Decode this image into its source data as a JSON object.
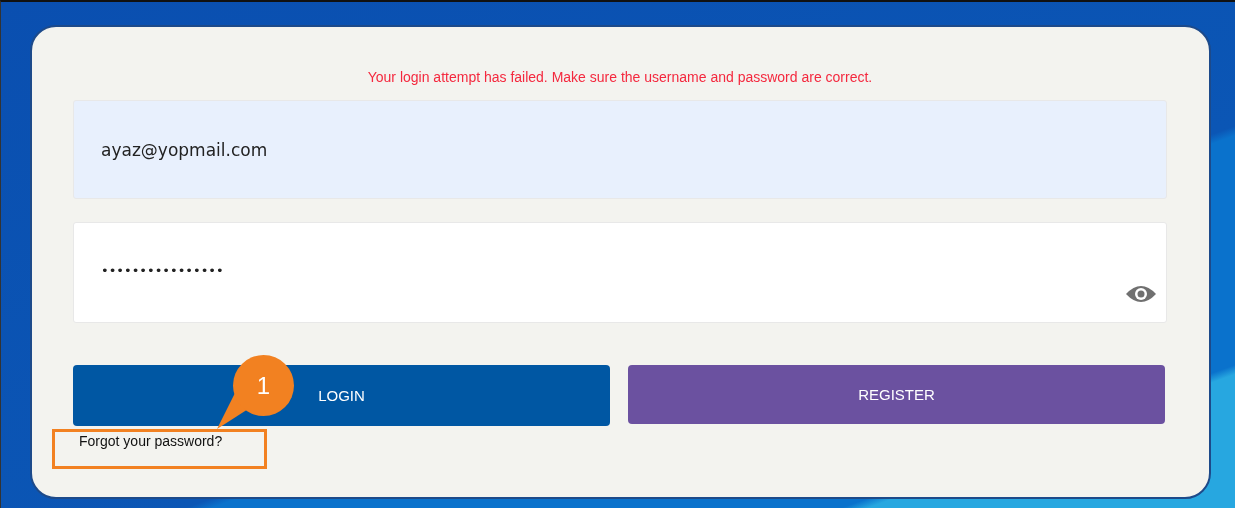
{
  "error_message": "Your login attempt has failed. Make sure the username and password are correct.",
  "email_field": {
    "value": "ayaz@yopmail.com"
  },
  "password_field": {
    "value": "••••••••••••••••"
  },
  "buttons": [
    {
      "label": "LOGIN",
      "kind": "primary"
    },
    {
      "label": "REGISTER",
      "kind": "secondary"
    }
  ],
  "forgot_link": "Forgot your password?",
  "annotation": {
    "number": "1"
  }
}
